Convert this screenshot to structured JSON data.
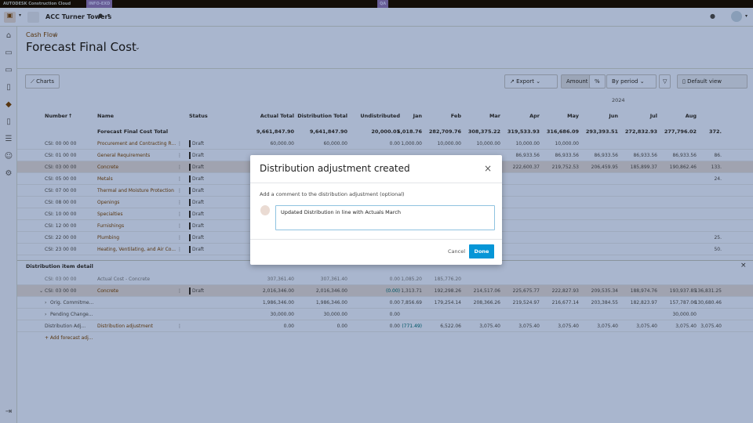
{
  "topbar": {
    "brand": "AUTODESK Construction Cloud",
    "env_badge": "INFO-EXD",
    "qa_badge": "QA"
  },
  "project": {
    "name": "ACC Turner Towers"
  },
  "breadcrumb": {
    "parent": "Cash Flow",
    "sep": "/"
  },
  "page": {
    "title": "Forecast Final Cost"
  },
  "toolbar": {
    "charts": "Charts",
    "export": "Export",
    "amount": "Amount",
    "percent": "%",
    "by_period": "By period",
    "default_view": "Default view"
  },
  "table": {
    "year": "2024",
    "headers": [
      "Number",
      "Name",
      "Status",
      "Actual Total",
      "Distribution Total",
      "Undistributed",
      "Jan",
      "Feb",
      "Mar",
      "Apr",
      "May",
      "Jun",
      "Jul",
      "Aug"
    ],
    "total": {
      "label": "Forecast Final Cost Total",
      "values": [
        "9,661,847.90",
        "9,641,847.90",
        "20,000.01",
        "5,018.76",
        "282,709.76",
        "308,375.22",
        "319,533.93",
        "316,686.09",
        "293,393.51",
        "272,832.93",
        "277,796.02",
        "372."
      ]
    },
    "rows": [
      {
        "number": "CSI: 00 00 00",
        "name": "Procurement and Contracting R...",
        "status": "Draft",
        "values": [
          "60,000.00",
          "60,000.00",
          "0.00",
          "1,000.00",
          "10,000.00",
          "10,000.00",
          "10,000.00",
          "10,000.00",
          "",
          "",
          "",
          ""
        ]
      },
      {
        "number": "CSI: 01 00 00",
        "name": "General Requirements",
        "status": "Draft",
        "values": [
          "",
          "",
          "",
          "",
          "",
          "",
          "86,933.56",
          "86,933.56",
          "86,933.56",
          "86,933.56",
          "86,933.56",
          "86."
        ]
      },
      {
        "number": "CSI: 03 00 00",
        "name": "Concrete",
        "status": "Draft",
        "selected": true,
        "values": [
          "",
          "",
          "",
          "",
          "",
          "",
          "222,600.37",
          "219,752.53",
          "206,459.95",
          "185,899.37",
          "190,862.46",
          "133."
        ]
      },
      {
        "number": "CSI: 05 00 00",
        "name": "Metals",
        "status": "Draft",
        "values": [
          "",
          "",
          "",
          "",
          "",
          "",
          "",
          "",
          "",
          "",
          "",
          "24."
        ]
      },
      {
        "number": "CSI: 07 00 00",
        "name": "Thermal and Moisture Protection",
        "status": "Draft",
        "values": [
          "",
          "",
          "",
          "",
          "",
          "",
          "",
          "",
          "",
          "",
          "",
          ""
        ]
      },
      {
        "number": "CSI: 08 00 00",
        "name": "Openings",
        "status": "Draft",
        "values": [
          "",
          "",
          "",
          "",
          "",
          "",
          "",
          "",
          "",
          "",
          "",
          ""
        ]
      },
      {
        "number": "CSI: 10 00 00",
        "name": "Specialties",
        "status": "Draft",
        "values": [
          "",
          "",
          "",
          "",
          "",
          "",
          "",
          "",
          "",
          "",
          "",
          ""
        ]
      },
      {
        "number": "CSI: 12 00 00",
        "name": "Furnishings",
        "status": "Draft",
        "values": [
          "",
          "",
          "",
          "",
          "",
          "",
          "",
          "",
          "",
          "",
          "",
          ""
        ]
      },
      {
        "number": "CSI: 22 00 00",
        "name": "Plumbing",
        "status": "Draft",
        "values": [
          "",
          "",
          "",
          "",
          "",
          "",
          "",
          "",
          "",
          "",
          "",
          "25."
        ]
      },
      {
        "number": "CSI: 23 00 00",
        "name": "Heating, Ventilating, and Air Co...",
        "status": "Draft",
        "values": [
          "",
          "",
          "",
          "",
          "",
          "",
          "",
          "",
          "",
          "",
          "",
          "50."
        ]
      }
    ]
  },
  "detail": {
    "title": "Distribution item detail",
    "rows": [
      {
        "number": "CSI: 03 00 00",
        "name": "Actual Cost - Concrete",
        "muted": true,
        "values": [
          "307,361.40",
          "307,361.40",
          "0.00",
          "1,085.20",
          "185,776.20",
          "",
          "",
          "",
          "",
          "",
          "",
          ""
        ]
      },
      {
        "number": "CSI: 03 00 00",
        "name": "Concrete",
        "status": "Draft",
        "expander": "v",
        "selected": true,
        "values": [
          "2,016,346.00",
          "2,016,346.00",
          "(0.00)",
          "1,313.71",
          "192,298.26",
          "214,517.06",
          "225,675.77",
          "222,827.93",
          "209,535.34",
          "188,974.76",
          "193,937.85",
          "136,831.25"
        ]
      },
      {
        "number": "Orig. Commitme...",
        "name": "",
        "expander": ">",
        "values": [
          "1,986,346.00",
          "1,986,346.00",
          "0.00",
          "7,856.69",
          "179,254.14",
          "208,366.26",
          "219,524.97",
          "216,677.14",
          "203,384.55",
          "182,823.97",
          "157,787.06",
          "130,680.46"
        ]
      },
      {
        "number": "Pending Change...",
        "name": "",
        "expander": ">",
        "values": [
          "30,000.00",
          "30,000.00",
          "0.00",
          "",
          "",
          "",
          "",
          "",
          "",
          "",
          "30,000.00",
          ""
        ]
      },
      {
        "number": "Distribution Adj...",
        "name": "Distribution adjustment",
        "values": [
          "0.00",
          "0.00",
          "0.00",
          "(771.49)",
          "6,522.06",
          "3,075.40",
          "3,075.40",
          "3,075.40",
          "3,075.40",
          "3,075.40",
          "3,075.40",
          "3,075.40"
        ]
      }
    ],
    "add_link": "+ Add forecast adj..."
  },
  "modal": {
    "title": "Distribution adjustment created",
    "label": "Add a comment to the distribution adjustment (optional)",
    "comment": "Updated Distribution in line with Actuals March",
    "cancel": "Cancel",
    "done": "Done"
  },
  "colors": {
    "accent": "#0696d7",
    "link": "#1f5aa0",
    "overlay": "#1c3460"
  }
}
